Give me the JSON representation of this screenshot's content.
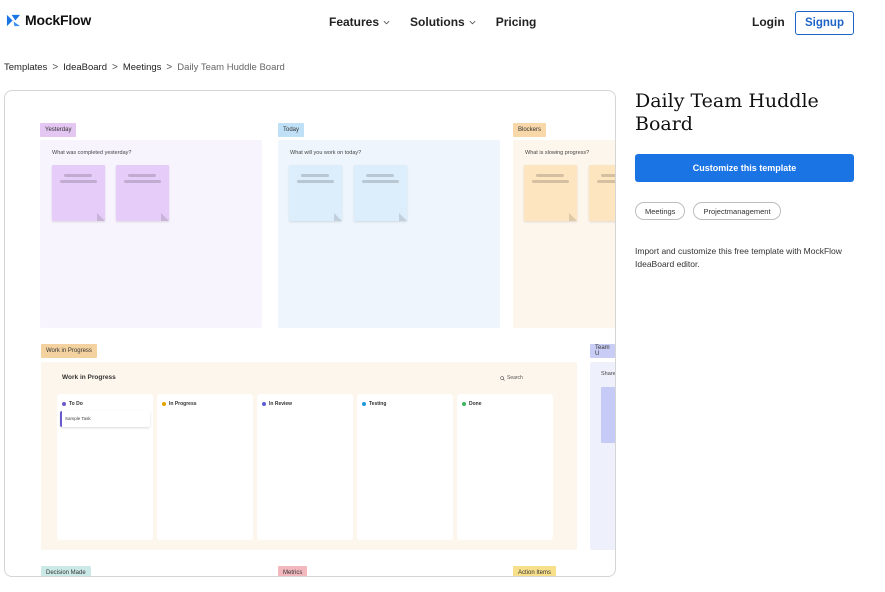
{
  "header": {
    "brand": "MockFlow",
    "nav": [
      {
        "label": "Features",
        "has_dropdown": true
      },
      {
        "label": "Solutions",
        "has_dropdown": true
      },
      {
        "label": "Pricing",
        "has_dropdown": false
      }
    ],
    "login_label": "Login",
    "signup_label": "Signup"
  },
  "breadcrumb": {
    "items": [
      "Templates",
      "IdeaBoard",
      "Meetings"
    ],
    "current": "Daily Team Huddle Board",
    "separator": ">"
  },
  "preview": {
    "sections": [
      {
        "tag": "Yesterday",
        "question": "What was completed yesterday?",
        "tag_color": "#e3c6f2",
        "panel_color": "#f8f4fe",
        "sticky_color": "#e6ccf8"
      },
      {
        "tag": "Today",
        "question": "What will you work on today?",
        "tag_color": "#bfe0f6",
        "panel_color": "#eef5fd",
        "sticky_color": "#dcedfb"
      },
      {
        "tag": "Blockers",
        "question": "What is slowing progress?",
        "tag_color": "#f8d7a8",
        "panel_color": "#fdf6ec",
        "sticky_color": "#fde5c0"
      }
    ],
    "wip": {
      "tag": "Work in Progress",
      "tag_color": "#f3d2a0",
      "title": "Work in Progress",
      "search_label": "Search",
      "columns": [
        {
          "label": "To Do",
          "color": "#6a5acd"
        },
        {
          "label": "In Progress",
          "color": "#e2a200"
        },
        {
          "label": "In Review",
          "color": "#5b5bd6"
        },
        {
          "label": "Testing",
          "color": "#1b9ae0"
        },
        {
          "label": "Done",
          "color": "#3cb45a"
        }
      ],
      "sample_task": "Sample Task"
    },
    "team": {
      "tag": "Team U",
      "share_label": "Share",
      "tag_color": "#c9cdf5"
    },
    "bottom_tags": [
      {
        "label": "Decision Made",
        "color": "#cbe9e6"
      },
      {
        "label": "Metrics",
        "color": "#f2b8be"
      },
      {
        "label": "Action Items",
        "color": "#f8e08a"
      }
    ]
  },
  "details": {
    "title": "Daily Team Huddle Board",
    "cta_label": "Customize this template",
    "tags": [
      "Meetings",
      "Projectmanagement"
    ],
    "description": "Import and customize this free template with MockFlow IdeaBoard editor."
  },
  "colors": {
    "brand_blue": "#1b74e4",
    "signup_border": "#1e63c8"
  }
}
